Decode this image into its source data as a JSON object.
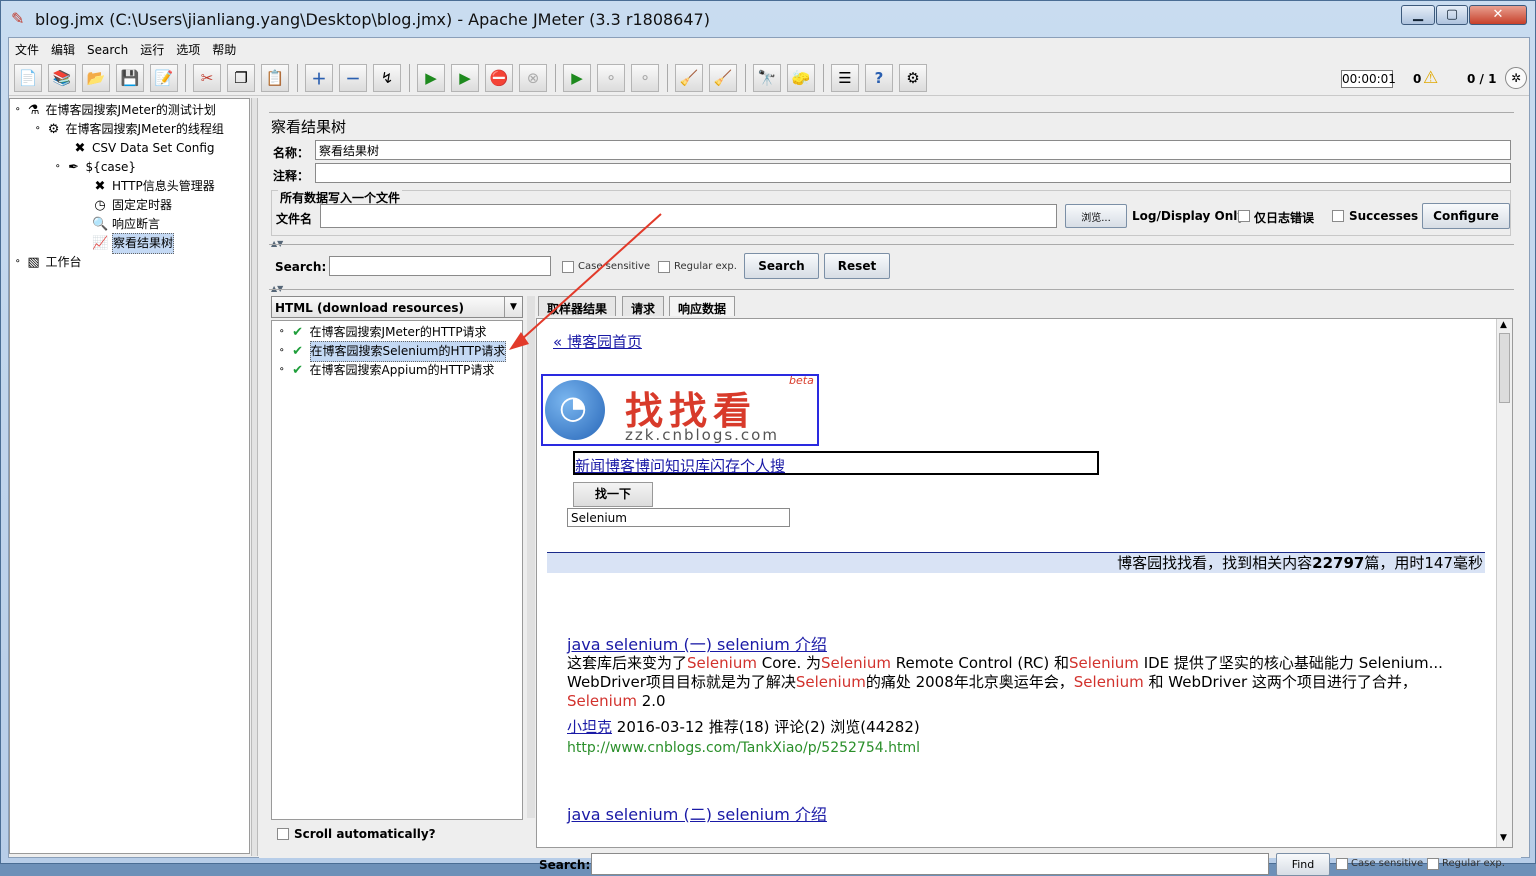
{
  "window": {
    "title": "blog.jmx (C:\\Users\\jianliang.yang\\Desktop\\blog.jmx) - Apache JMeter (3.3 r1808647)",
    "min": "▁",
    "max": "▢",
    "close": "✕"
  },
  "menu": [
    "文件",
    "编辑",
    "Search",
    "运行",
    "选项",
    "帮助"
  ],
  "status": {
    "timer": "00:00:01",
    "warnings": "0",
    "threads": "0 / 1"
  },
  "tree": {
    "items": [
      {
        "label": "在博客园搜索JMeter的测试计划",
        "icon": "flask-icon"
      },
      {
        "label": "在博客园搜索JMeter的线程组",
        "icon": "gear-icon"
      },
      {
        "label": "CSV Data Set Config",
        "icon": "tools-icon"
      },
      {
        "label": "${case}",
        "icon": "pipette-icon"
      },
      {
        "label": "HTTP信息头管理器",
        "icon": "tools-icon"
      },
      {
        "label": "固定定时器",
        "icon": "clock-icon"
      },
      {
        "label": "响应断言",
        "icon": "magnifier-icon"
      },
      {
        "label": "察看结果树",
        "icon": "chart-icon"
      },
      {
        "label": "工作台",
        "icon": "workbench-icon"
      }
    ]
  },
  "panel": {
    "title": "察看结果树",
    "name_label": "名称：",
    "name_value": "察看结果树",
    "comment_label": "注释：",
    "comment_value": "",
    "group_label": "所有数据写入一个文件",
    "file_label": "文件名",
    "file_value": "",
    "browse": "浏览...",
    "log_label": "Log/Display Only:",
    "errors_only": "仅日志错误",
    "successes": "Successes",
    "configure": "Configure"
  },
  "search": {
    "label": "Search:",
    "value": "",
    "case": "Case sensitive",
    "regex": "Regular exp.",
    "search_btn": "Search",
    "reset_btn": "Reset"
  },
  "renderer": {
    "selected": "HTML (download resources)"
  },
  "results": [
    {
      "label": "在博客园搜索JMeter的HTTP请求"
    },
    {
      "label": "在博客园搜索Selenium的HTTP请求"
    },
    {
      "label": "在博客园搜索Appium的HTTP请求"
    }
  ],
  "scroll_auto": "Scroll automatically?",
  "tabs": [
    "取样器结果",
    "请求",
    "响应数据"
  ],
  "response": {
    "home_link": "« 博客园首页",
    "logo_text": "找找看",
    "logo_beta": "beta",
    "logo_sub": "zzk.cnblogs.com",
    "categories": "新闻博客博问知识库闪存个人搜",
    "search_btn": "找一下",
    "search_value": "Selenium",
    "summary_prefix": "博客园找找看，找到相关内容",
    "summary_count": "22797",
    "summary_mid": "篇，用时",
    "summary_ms": "147",
    "summary_suffix": "毫秒",
    "result_title": "java selenium (一) selenium 介绍",
    "line1_a": "这套库后来变为了",
    "kw": "Selenium",
    "line1_b": " Core. 为",
    "line1_c": " Remote Control (RC) 和",
    "line1_d": " IDE 提供了坚实的核心基础能力 Selenium...",
    "line2_a": "WebDriver项目目标就是为了解决",
    "line2_b": "的痛处 2008年北京奥运年会，",
    "line2_c": " 和 WebDriver 这两个项目进行了合并，",
    "line3_b": " 2.0",
    "author": "小坦克",
    "meta": " 2016-03-12 推荐(18) 评论(2) 浏览(44282)",
    "url": "http://www.cnblogs.com/TankXiao/p/5252754.html",
    "next_title": "java selenium (二) selenium 介绍"
  },
  "bottom_search": {
    "label": "Search:",
    "value": "",
    "find": "Find",
    "case": "Case sensitive",
    "regex": "Regular exp."
  }
}
